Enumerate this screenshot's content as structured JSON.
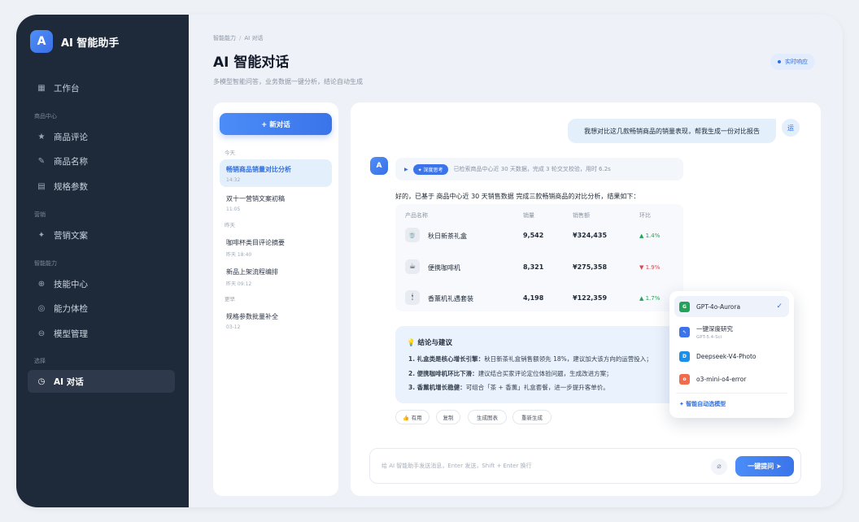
{
  "brand": {
    "logo": "A",
    "name": "AI 智能助手"
  },
  "sidebar": {
    "items": [
      {
        "label": "工作台",
        "icon": "grid-icon"
      },
      {
        "section": "商品中心"
      },
      {
        "label": "商品评论",
        "icon": "star-icon"
      },
      {
        "label": "商品名称",
        "icon": "pen-icon"
      },
      {
        "label": "规格参数",
        "icon": "table-icon"
      },
      {
        "section": "营销"
      },
      {
        "label": "营销文案",
        "icon": "sparkle-icon"
      },
      {
        "section": "智能能力"
      },
      {
        "label": "技能中心",
        "icon": "plus-circle-icon"
      },
      {
        "label": "能力体检",
        "icon": "target-icon"
      },
      {
        "label": "模型管理",
        "icon": "globe-icon"
      },
      {
        "section": "选择"
      },
      {
        "label": "AI 对话",
        "icon": "clock-icon",
        "active": true
      }
    ]
  },
  "header": {
    "breadcrumb": [
      "智能能力",
      "AI 对话"
    ],
    "title": "AI 智能对话",
    "subtitle": "多模型智能问答，业务数据一键分析，结论自动生成",
    "badge": "实时响应"
  },
  "conversations": {
    "new_label": "+ 新对话",
    "groups": [
      {
        "label": "今天",
        "items": [
          {
            "title": "畅销商品销量对比分析",
            "time": "14:32",
            "active": true
          },
          {
            "title": "双十一营销文案初稿",
            "time": "11:05"
          }
        ]
      },
      {
        "label": "昨天",
        "items": [
          {
            "title": "咖啡杯类目评论摘要",
            "time": "昨天 18:40"
          },
          {
            "title": "新品上架流程编排",
            "time": "昨天 09:12"
          }
        ]
      },
      {
        "label": "更早",
        "items": [
          {
            "title": "规格参数批量补全",
            "time": "03-12"
          }
        ]
      }
    ]
  },
  "chat": {
    "user_message": "我想对比这几款畅销商品的销量表现，帮我生成一份对比报告",
    "user_avatar": "运",
    "ai_avatar": "A",
    "thinking": {
      "tag": "✦ 深度思考",
      "text": "已检索商品中心近 30 天数据，完成 3 轮交叉校验，用时 6.2s"
    },
    "answer": "好的，已基于 商品中心近 30 天销售数据 完成三款畅销商品的对比分析，结果如下：",
    "table": {
      "headers": [
        "产品名称",
        "销量",
        "销售额",
        "环比"
      ],
      "rows": [
        {
          "icon": "🍵",
          "name": "秋日新茶礼盒",
          "sales": "9,542",
          "revenue": "¥324,435",
          "change": "▲ 1.4%",
          "dir": "up"
        },
        {
          "icon": "☕",
          "name": "便携咖啡机",
          "sales": "8,321",
          "revenue": "¥275,358",
          "change": "▼ 1.9%",
          "dir": "down"
        },
        {
          "icon": "🕯",
          "name": "香薰机礼遇套装",
          "sales": "4,198",
          "revenue": "¥122,359",
          "change": "▲ 1.7%",
          "dir": "up"
        }
      ]
    },
    "conclusion": {
      "title": "💡 结论与建议",
      "lines": [
        {
          "head": "1. 礼盒类是核心增长引擎：",
          "body": "秋日新茶礼盒销售额领先 18%，建议加大该方向的运营投入；"
        },
        {
          "head": "2. 便携咖啡机环比下滑：",
          "body": "建议结合买家评论定位体验问题，生成改进方案；"
        },
        {
          "head": "3. 香薰机增长稳健：",
          "body": "可组合「茶 + 香薰」礼盒套餐，进一步提升客单价。"
        }
      ]
    },
    "actions": [
      "👍 有用",
      "复制",
      "生成图表",
      "重新生成"
    ],
    "input_placeholder": "给 AI 智能助手发送消息，Enter 发送，Shift + Enter 换行",
    "send_label": "一键提问 ➤"
  },
  "model_menu": {
    "items": [
      {
        "name": "GPT-4o-Aurora",
        "sub": "",
        "icon": "G",
        "color": "#22a35a",
        "selected": true
      },
      {
        "name": "一键深度研究",
        "sub": "GPT-5.4-Sci",
        "icon": "➴",
        "color": "#3b74ea",
        "selected": false
      },
      {
        "name": "Deepseek-V4-Photo",
        "sub": "",
        "icon": "D",
        "color": "#1d8fe6",
        "selected": false
      },
      {
        "name": "o3-mini-o4-error",
        "sub": "",
        "icon": "o",
        "color": "#f26b4a",
        "selected": false
      }
    ],
    "auto_label": "✦ 智能自动选模型"
  }
}
